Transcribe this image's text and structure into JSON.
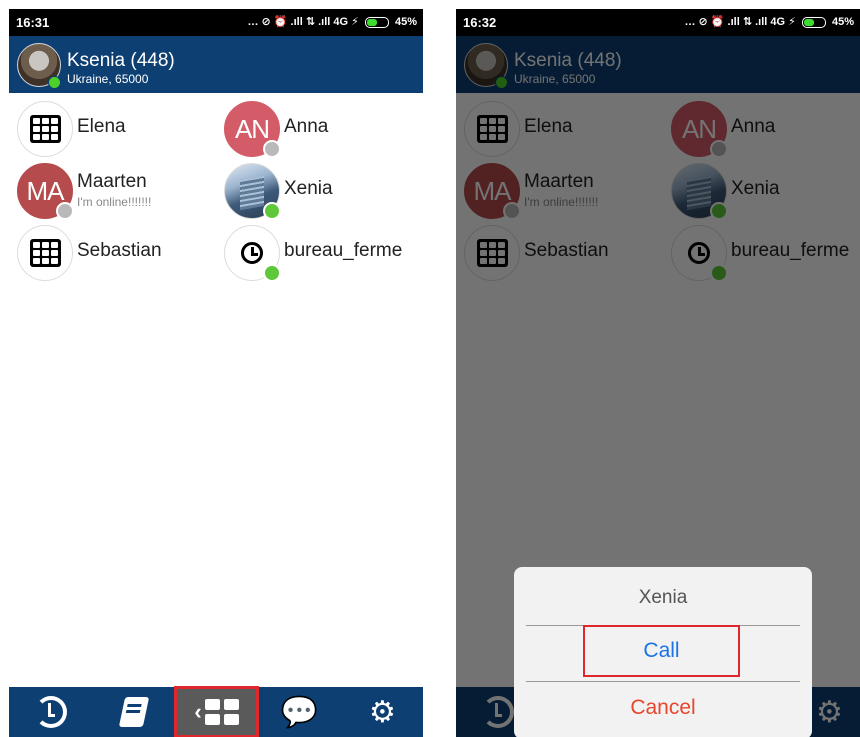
{
  "screen_left": {
    "status": {
      "time": "16:31",
      "indicators": "… ⊘ ⏰ .ıll ⇅ .ıll 4G ⚡",
      "battery": "45%"
    },
    "header": {
      "name": "Ksenia (448)",
      "location": "Ukraine, 65000"
    },
    "contacts": [
      {
        "name": "Elena",
        "avatar": "grid-icon",
        "status": "",
        "presence": "offline"
      },
      {
        "name": "Anna",
        "avatar_initials": "AN",
        "status": "",
        "presence": "offline"
      },
      {
        "name": "Maarten",
        "avatar_initials": "MA",
        "status": "I'm online!!!!!!!",
        "presence": "offline"
      },
      {
        "name": "Xenia",
        "avatar": "building-photo",
        "status": "",
        "presence": "online"
      },
      {
        "name": "Sebastian",
        "avatar": "grid-icon",
        "status": "",
        "presence": "none"
      },
      {
        "name": "bureau_ferme",
        "avatar": "clock-icon",
        "status": "",
        "presence": "online"
      }
    ],
    "tabs": [
      "recent-calls-icon",
      "phonebook-icon",
      "contacts-grid-icon",
      "chat-icon",
      "settings-gears-icon"
    ],
    "selected_tab": "contacts-grid-icon"
  },
  "screen_right": {
    "status": {
      "time": "16:32",
      "indicators": "… ⊘ ⏰ .ıll ⇅ .ıll 4G ⚡",
      "battery": "45%"
    },
    "dialog": {
      "title": "Xenia",
      "call_label": "Call",
      "cancel_label": "Cancel"
    }
  },
  "colors": {
    "header": "#0d3f73",
    "online": "#5ec83a",
    "offline": "#b9b9b9",
    "call": "#1a73e8",
    "cancel": "#e8452d",
    "highlight": "#e0282c"
  }
}
